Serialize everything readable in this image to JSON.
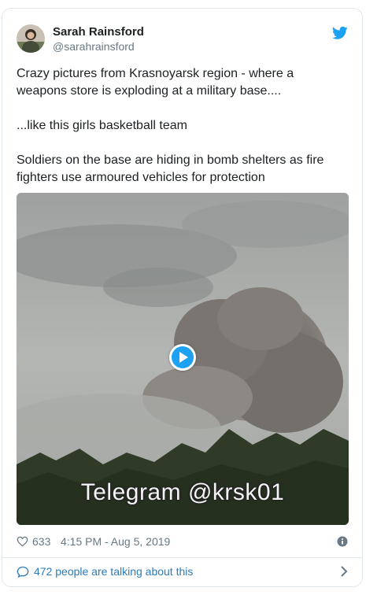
{
  "author": {
    "name": "Sarah Rainsford",
    "handle": "@sarahrainsford"
  },
  "tweet": {
    "text": "Crazy pictures from Krasnoyarsk region - where a weapons store is exploding at a military base....\n\n...like this girls basketball team\n\nSoldiers on the  base are hiding in bomb shelters as fire fighters use armoured vehicles for protection"
  },
  "media": {
    "watermark": "Telegram @krsk01"
  },
  "meta": {
    "likes": "633",
    "timestamp": "4:15 PM - Aug 5, 2019"
  },
  "footer": {
    "label": "472 people are talking about this"
  },
  "colors": {
    "brand_blue": "#1da1f2",
    "link_blue": "#2b7bb9",
    "muted": "#697882",
    "border": "#e1e8ed"
  },
  "icons": [
    "twitter-bird-icon",
    "play-icon",
    "heart-icon",
    "info-icon",
    "speech-bubble-icon",
    "chevron-right-icon"
  ]
}
